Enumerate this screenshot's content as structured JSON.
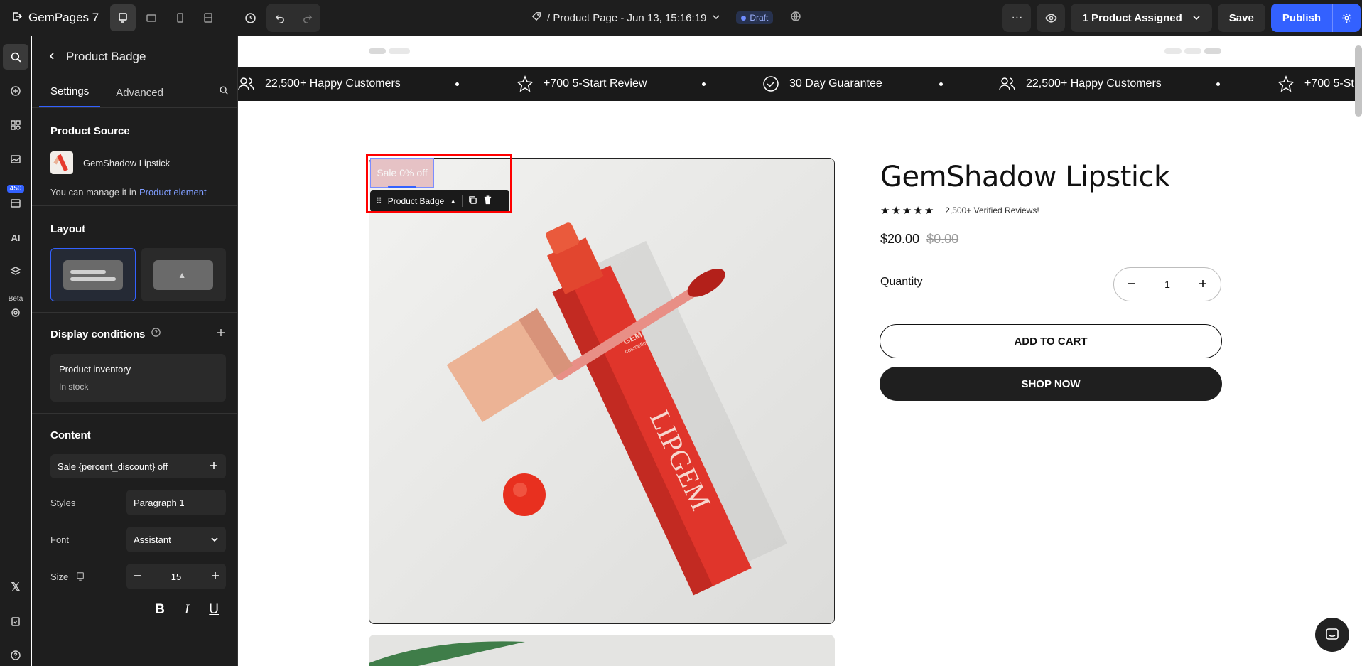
{
  "topbar": {
    "logo": "GemPages 7",
    "page_title": "/ Product Page - Jun 13, 15:16:19",
    "draft_label": "Draft",
    "assigned_label": "1 Product Assigned",
    "save_label": "Save",
    "publish_label": "Publish"
  },
  "rail": {
    "badge_count": "450",
    "ai_label": "AI",
    "beta_label": "Beta"
  },
  "panel": {
    "title": "Product Badge",
    "tabs": [
      "Settings",
      "Advanced"
    ],
    "product_source": {
      "title": "Product Source",
      "product_name": "GemShadow Lipstick",
      "manage_text": "You can manage it in",
      "manage_link": "Product element"
    },
    "layout": {
      "title": "Layout"
    },
    "display_conditions": {
      "title": "Display conditions",
      "condition_name": "Product inventory",
      "condition_value": "In stock"
    },
    "content": {
      "title": "Content",
      "text_value": "Sale {percent_discount} off",
      "styles_label": "Styles",
      "styles_value": "Paragraph 1",
      "font_label": "Font",
      "font_value": "Assistant",
      "size_label": "Size",
      "size_value": "15"
    }
  },
  "canvas": {
    "marquee": [
      "22,500+ Happy Customers",
      "+700 5-Start Review",
      "30 Day Guarantee",
      "22,500+ Happy Customers",
      "+700 5-St"
    ],
    "badge_text": "Sale 0% off",
    "badge_toolbar_label": "Product Badge",
    "product_image_brand": "GEM",
    "product_image_sub": "cosmetics",
    "product_image_logo": "LIPGEM",
    "product_title": "GemShadow Lipstick",
    "reviews_text": "2,500+ Verified Reviews!",
    "price": "$20.00",
    "compare_price": "$0.00",
    "quantity_label": "Quantity",
    "quantity_value": "1",
    "add_to_cart": "ADD TO CART",
    "shop_now": "SHOP NOW"
  },
  "colors": {
    "accent": "#3361ff",
    "selection": "#ff0000",
    "dark": "#1e1e1e"
  }
}
